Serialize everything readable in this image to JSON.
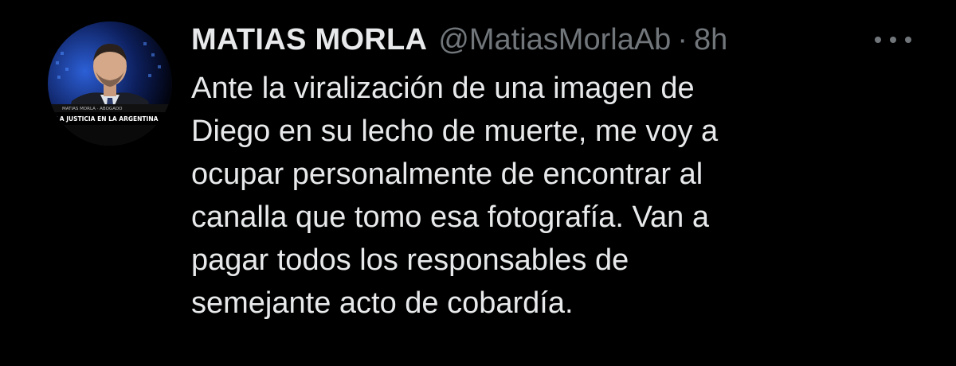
{
  "tweet": {
    "author": {
      "display_name": "MATIAS MORLA",
      "handle": "@MatiasMorlaAb",
      "avatar_caption_top": "MATIAS MORLA · ABOGADO",
      "avatar_caption_main": "LA JUSTICIA EN LA ARGENTINA"
    },
    "separator": "·",
    "timestamp": "8h",
    "text_lines": [
      "Ante la viralización de una imagen de",
      "Diego en su lecho de muerte, me voy a",
      "ocupar personalmente de encontrar al",
      "canalla que tomo esa fotografía. Van a",
      "pagar todos los responsables de",
      "semejante acto de cobardía."
    ],
    "more_icon": "more-horizontal-icon"
  },
  "colors": {
    "background": "#000000",
    "primary_text": "#e7e9ea",
    "secondary_text": "#71767b"
  }
}
